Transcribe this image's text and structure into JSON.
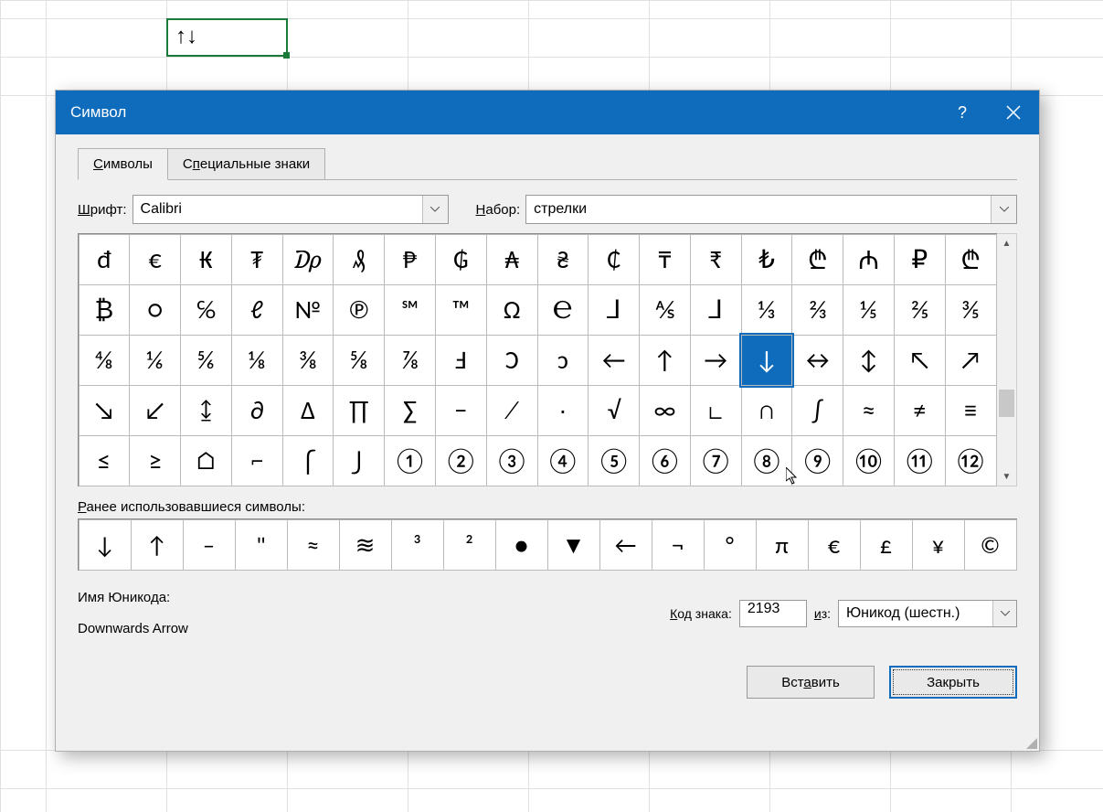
{
  "cell_content": "↑↓",
  "dialog_title": "Символ",
  "tabs": {
    "symbols": "Символы",
    "special": "Специальные знаки"
  },
  "font_label": "Шрифт:",
  "font_value": "Calibri",
  "subset_label": "Набор:",
  "subset_value": "стрелки",
  "grid_rows": [
    [
      "đ",
      "€",
      "₭",
      "₮",
      "₯",
      "₰",
      "₱",
      "₲",
      "₳",
      "₴",
      "₵",
      "₸",
      "₹",
      "₺",
      "₾",
      "₼",
      "₽",
      "₾"
    ],
    [
      "₿",
      "○",
      "℅",
      "ℓ",
      "№",
      "℗",
      "℠",
      "™",
      "Ω",
      "℮",
      "⅃",
      "⅍",
      "⅃",
      "⅓",
      "⅔",
      "⅕",
      "⅖",
      "⅗"
    ],
    [
      "⅘",
      "⅙",
      "⅚",
      "⅛",
      "⅜",
      "⅝",
      "⅞",
      "Ⅎ",
      "Ↄ",
      "ↄ",
      "←",
      "↑",
      "→",
      "↓",
      "↔",
      "↕",
      "↖",
      "↗"
    ],
    [
      "↘",
      "↙",
      "↨",
      "∂",
      "∆",
      "∏",
      "∑",
      "−",
      "∕",
      "∙",
      "√",
      "∞",
      "∟",
      "∩",
      "∫",
      "≈",
      "≠",
      "≡"
    ],
    [
      "≤",
      "≥",
      "⌂",
      "⌐",
      "⌠",
      "⌡",
      "①",
      "②",
      "③",
      "④",
      "⑤",
      "⑥",
      "⑦",
      "⑧",
      "⑨",
      "⑩",
      "⑪",
      "⑫"
    ]
  ],
  "selected_index": {
    "row": 2,
    "col": 13
  },
  "recent_label": "Ранее использовавшиеся символы:",
  "recent": [
    "↓",
    "↑",
    "–",
    "\"",
    "≈",
    "≋",
    "³",
    "²",
    "●",
    "▼",
    "←",
    "¬",
    "°",
    "π",
    "€",
    "£",
    "¥",
    "©"
  ],
  "unicode_name_label": "Имя Юникода:",
  "unicode_name": "Downwards Arrow",
  "code_label": "Код знака:",
  "code_value": "2193",
  "from_label": "из:",
  "from_value": "Юникод (шестн.)",
  "insert_btn": "Вставить",
  "close_btn": "Закрыть"
}
